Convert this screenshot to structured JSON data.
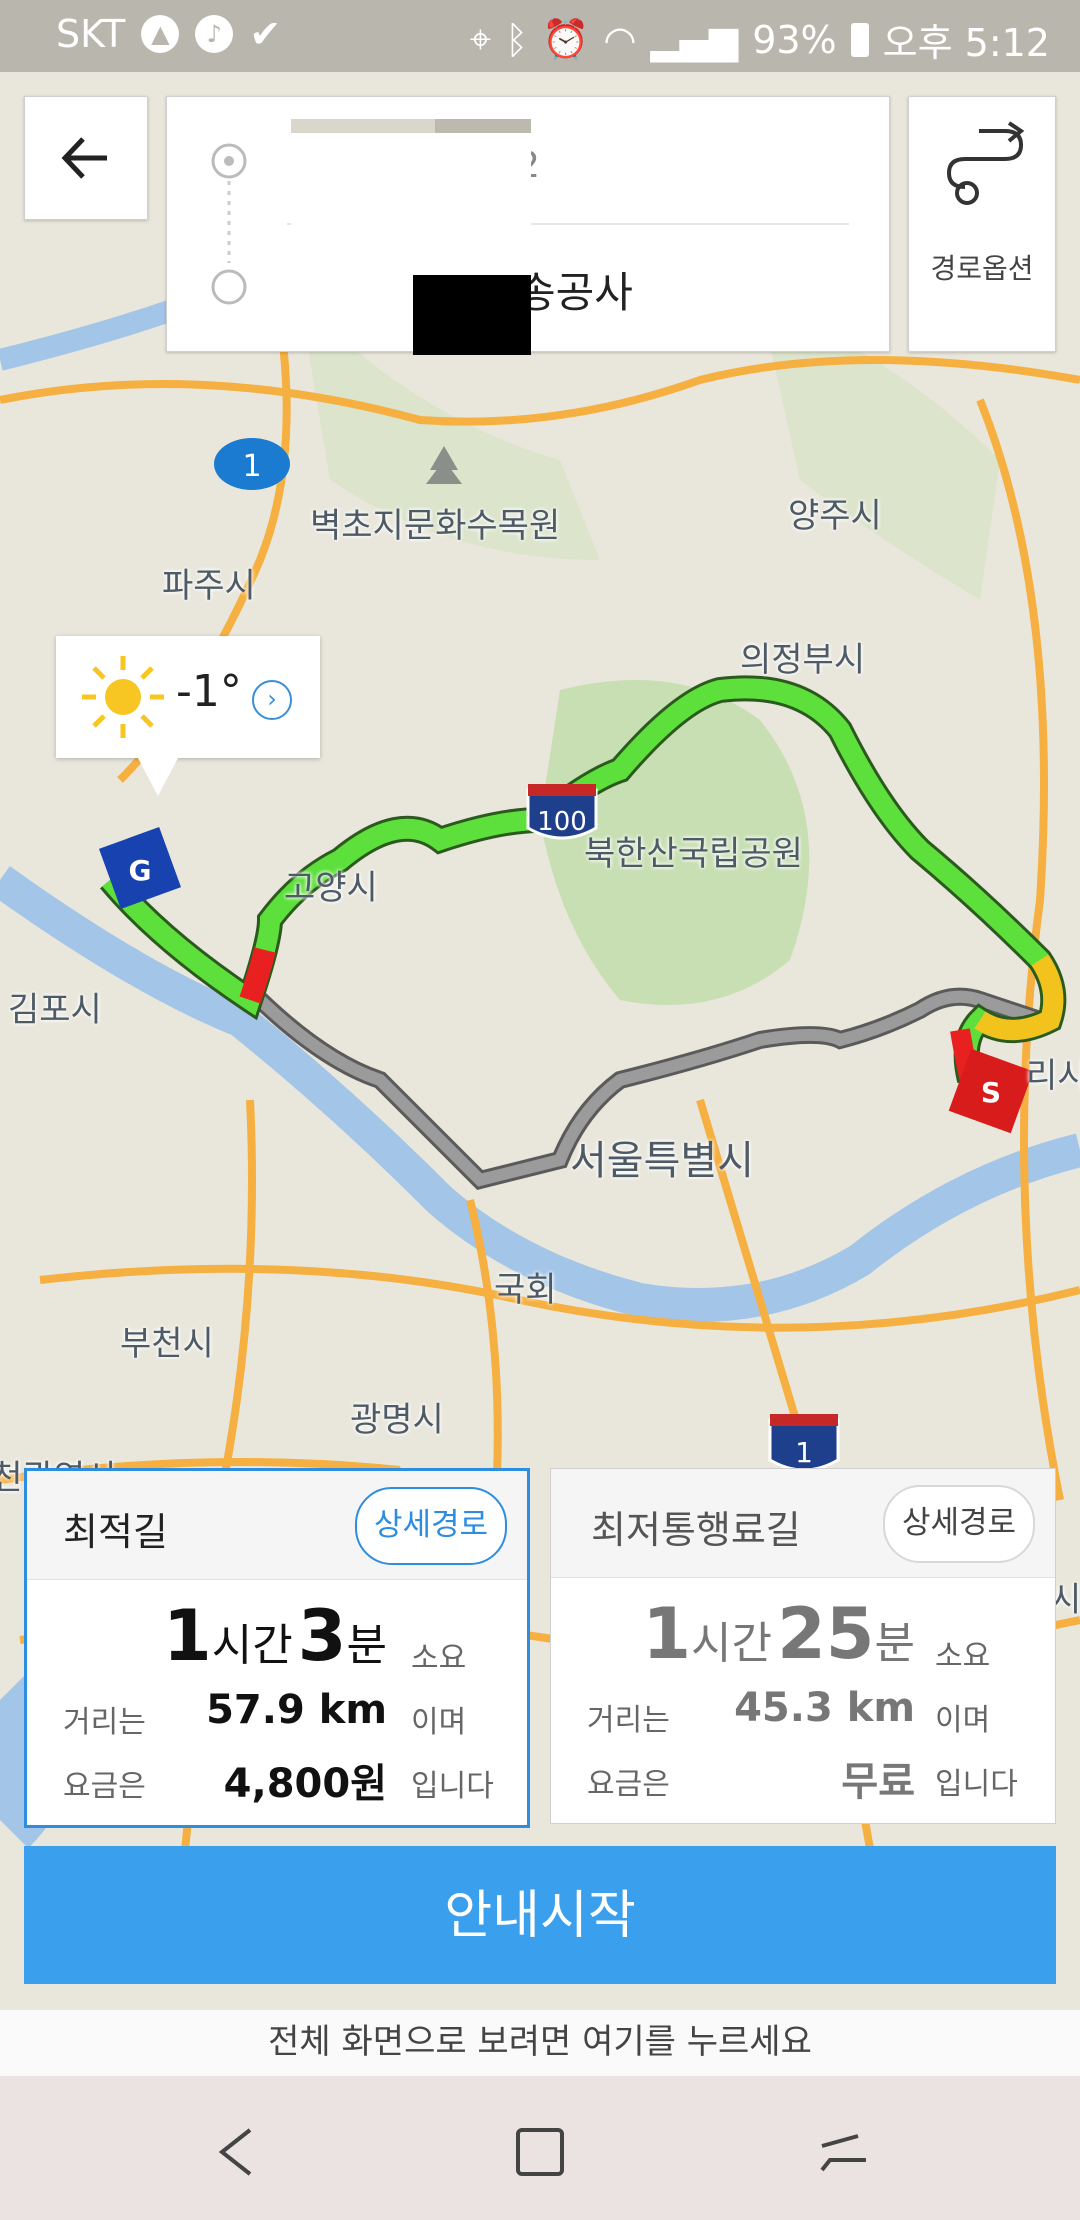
{
  "status_bar": {
    "carrier": "SKT",
    "battery": "93%",
    "time": "오후 5:12",
    "icons": [
      "nav-icon",
      "music-icon",
      "check-icon",
      "location-icon",
      "bluetooth-icon",
      "alarm-icon",
      "wifi-icon",
      "signal-icon",
      "battery-icon"
    ]
  },
  "search": {
    "origin_partial": "2",
    "destination_partial": "송공사",
    "route_option_label": "경로옵션"
  },
  "map": {
    "labels": {
      "byeokcho": "벽초지문화수목원",
      "paju": "파주시",
      "yangju": "양주시",
      "uijeongbu": "의정부시",
      "bukhansan": "북한산국립공원",
      "goyang": "고양시",
      "gimpo": "김포시",
      "seoul": "서울특별시",
      "gukhoe": "국회",
      "bucheon": "부천시",
      "gwangmyeong": "광명시",
      "guri": "리시",
      "incheon": "인천광역시",
      "edge_right": "시"
    },
    "road_shields": {
      "route1_top": "1",
      "expressway100": "100",
      "expressway1": "1"
    },
    "weather": {
      "temperature": "-1°",
      "icon": "sun-icon"
    },
    "markers": {
      "start": "G",
      "end": "S"
    }
  },
  "routes": [
    {
      "title": "최적길",
      "detail_label": "상세경로",
      "hours": "1",
      "hours_unit": "시간",
      "minutes": "3",
      "minutes_unit": "분",
      "time_suffix": "소요",
      "distance_prefix": "거리는",
      "distance": "57.9 km",
      "distance_suffix": "이며",
      "toll_prefix": "요금은",
      "toll": "4,800원",
      "toll_suffix": "입니다",
      "selected": true
    },
    {
      "title": "최저통행료길",
      "detail_label": "상세경로",
      "hours": "1",
      "hours_unit": "시간",
      "minutes": "25",
      "minutes_unit": "분",
      "time_suffix": "소요",
      "distance_prefix": "거리는",
      "distance": "45.3 km",
      "distance_suffix": "이며",
      "toll_prefix": "요금은",
      "toll": "무료",
      "toll_suffix": "입니다",
      "selected": false
    }
  ],
  "start_button": "안내시작",
  "fullscreen_hint": "전체 화면으로 보려면 여기를 누르세요",
  "colors": {
    "primary": "#3aa0ee",
    "route_green": "#5ee03c",
    "route_gray": "#8a8a8a",
    "traffic_red": "#e82020",
    "traffic_yellow": "#f2c31c"
  }
}
